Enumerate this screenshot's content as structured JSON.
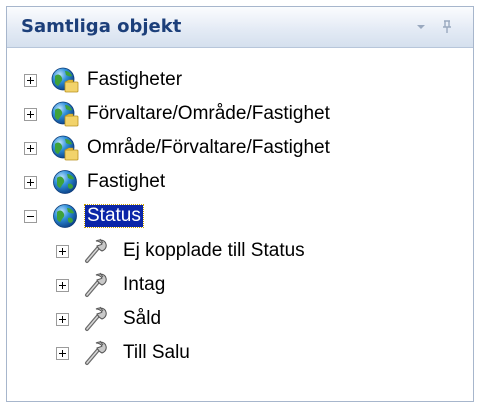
{
  "panel": {
    "title": "Samtliga objekt"
  },
  "header_icons": [
    "dropdown-arrow-icon",
    "pin-icon"
  ],
  "tree": {
    "root_nodes": [
      {
        "label": "Fastigheter",
        "icon": "globe-folder-icon",
        "expanded": false
      },
      {
        "label": "Förvaltare/Område/Fastighet",
        "icon": "globe-folder-icon",
        "expanded": false
      },
      {
        "label": "Område/Förvaltare/Fastighet",
        "icon": "globe-folder-icon",
        "expanded": false
      },
      {
        "label": "Fastighet",
        "icon": "globe-icon",
        "expanded": false
      },
      {
        "label": "Status",
        "icon": "globe-icon",
        "expanded": true,
        "selected": true
      }
    ],
    "status_children": [
      {
        "label": "Ej kopplade till Status",
        "icon": "wrench-icon"
      },
      {
        "label": "Intag",
        "icon": "wrench-icon"
      },
      {
        "label": "Såld",
        "icon": "wrench-icon"
      },
      {
        "label": "Till Salu",
        "icon": "wrench-icon"
      }
    ]
  }
}
